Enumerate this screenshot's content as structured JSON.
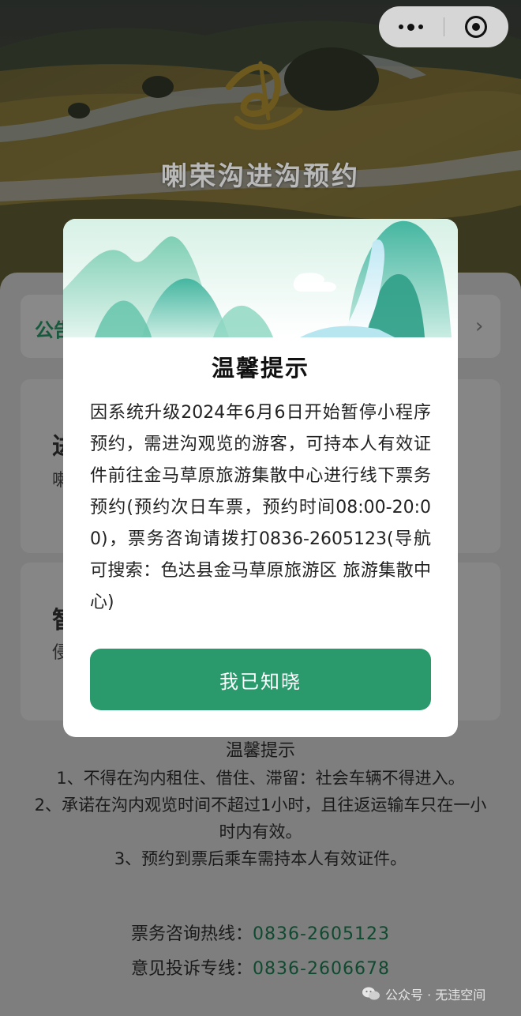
{
  "hero": {
    "title": "喇荣沟进沟预约"
  },
  "colors": {
    "accent": "#2a9a6c",
    "number_link": "#0f4a30"
  },
  "capsule": {
    "menu_icon": "more-dots-icon",
    "close_icon": "target-icon"
  },
  "notice": {
    "label": "公告",
    "arrow": "›"
  },
  "cards": {
    "card1_title": "进",
    "card1_sub": "喇",
    "card2_title": "智",
    "card2_sub": "侵"
  },
  "modal": {
    "title": "温馨提示",
    "body": "因系统升级2024年6月6日开始暂停小程序预约，需进沟观览的游客，可持本人有效证件前往金马草原旅游集散中心进行线下票务预约(预约次日车票，预约时间08:00-20:00)，票务咨询请拨打0836-2605123(导航可搜索：色达县金马草原旅游区 旅游集散中心)",
    "button": "我已知晓"
  },
  "tips": {
    "title": "温馨提示",
    "items": [
      "1、不得在沟内租住、借住、滞留：社会车辆不得进入。",
      "2、承诺在沟内观览时间不超过1小时，且往返运输车只在一小时内有效。",
      "3、预约到票后乘车需持本人有效证件。"
    ]
  },
  "hotlines": {
    "ticket_label": "票务咨询热线：",
    "ticket_number": "0836-2605123",
    "complaint_label": "意见投诉专线：",
    "complaint_number": "0836-2606678"
  },
  "watermark": {
    "text": "公众号 · 无违空间"
  }
}
